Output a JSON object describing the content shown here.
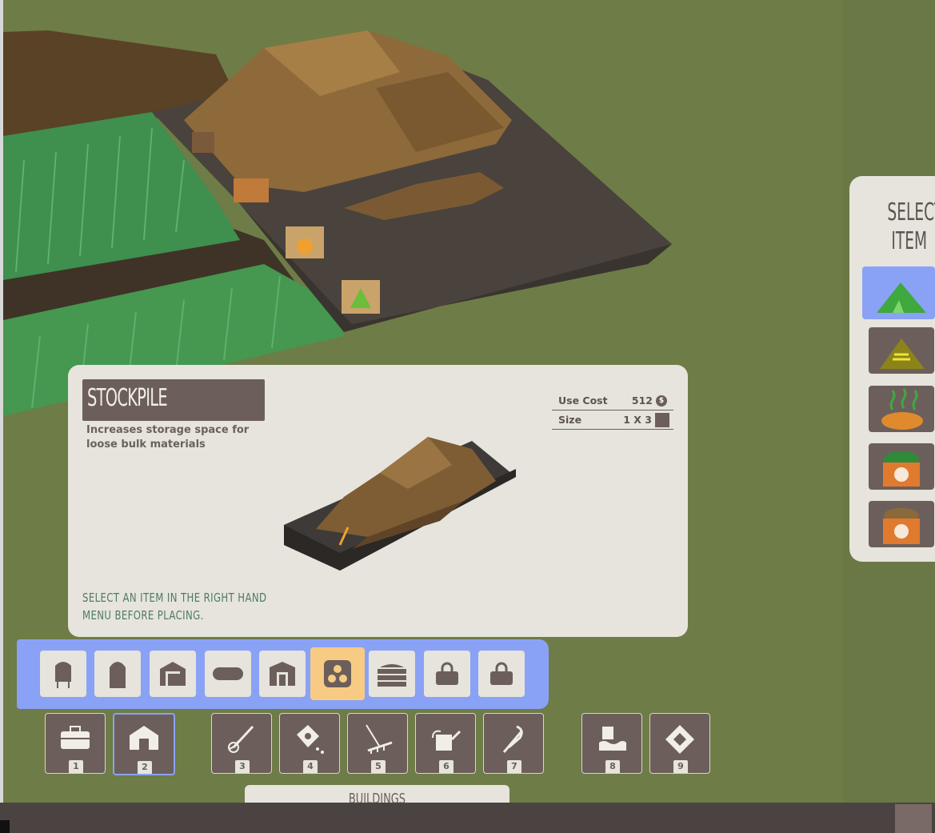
{
  "info_panel": {
    "title": "STOCKPILE",
    "description": "Increases storage space for loose bulk materials",
    "hint": "SELECT AN ITEM IN THE RIGHT HAND MENU BEFORE PLACING.",
    "stats": {
      "use_cost_label": "Use Cost",
      "use_cost_value": "512",
      "currency_symbol": "$",
      "size_label": "Size",
      "size_value": "1 X 3"
    }
  },
  "right_menu": {
    "title": "SELECT ITEM",
    "items": [
      {
        "icon": "grass-pile-icon",
        "selected": true
      },
      {
        "icon": "grain-pile-icon",
        "selected": false
      },
      {
        "icon": "compost-pile-icon",
        "selected": false
      },
      {
        "icon": "green-feed-bin-icon",
        "selected": false
      },
      {
        "icon": "chicken-feed-bin-icon",
        "selected": false
      }
    ]
  },
  "building_bar": {
    "items": [
      {
        "icon": "silo-icon"
      },
      {
        "icon": "tall-silo-icon"
      },
      {
        "icon": "garage-icon"
      },
      {
        "icon": "tank-icon"
      },
      {
        "icon": "barn-icon"
      },
      {
        "icon": "stockpile-icon",
        "selected": true
      },
      {
        "icon": "crate-stack-icon"
      },
      {
        "icon": "locked-icon"
      },
      {
        "icon": "locked-icon"
      }
    ]
  },
  "tools": [
    {
      "num": "1",
      "icon": "toolbox-icon"
    },
    {
      "num": "2",
      "icon": "building-icon",
      "active": true
    },
    {
      "num": "3",
      "icon": "cultivator-icon"
    },
    {
      "num": "4",
      "icon": "seed-bag-icon"
    },
    {
      "num": "5",
      "icon": "rake-icon"
    },
    {
      "num": "6",
      "icon": "watering-can-icon"
    },
    {
      "num": "7",
      "icon": "pruning-shears-icon"
    },
    {
      "num": "8",
      "icon": "terrain-icon"
    },
    {
      "num": "9",
      "icon": "sign-icon"
    }
  ],
  "category_label": "BUILDINGS",
  "colors": {
    "accent": "#8aa2f5",
    "selected": "#f8cb84",
    "panel": "#e6e4dc",
    "dark": "#6c5f5b",
    "ground": "#6e7c47"
  }
}
